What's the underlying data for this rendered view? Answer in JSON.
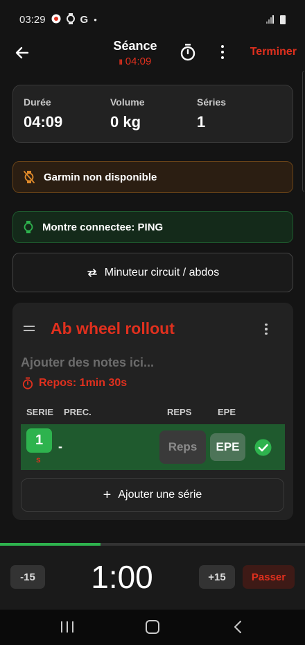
{
  "status_bar": {
    "time": "03:29",
    "icons": [
      "app-notification-icon",
      "watch-icon",
      "google-icon",
      "dot-icon",
      "signal-icon",
      "battery-icon"
    ],
    "google_glyph": "G",
    "dot_glyph": "•"
  },
  "header": {
    "title": "Séance",
    "timer": "04:09",
    "pause_glyph": "II",
    "finish_label": "Terminer"
  },
  "stats": {
    "duration_label": "Durée",
    "duration_value": "04:09",
    "volume_label": "Volume",
    "volume_value": "0 kg",
    "series_label": "Séries",
    "series_value": "1"
  },
  "garmin_banner": {
    "text": "Garmin non disponible",
    "icon": "watch-off-icon"
  },
  "watch_banner": {
    "text": "Montre connectee: PING",
    "icon": "watch-icon"
  },
  "circuit_timer": {
    "label": "Minuteur circuit / abdos",
    "icon": "repeat-icon"
  },
  "exercise": {
    "name": "Ab wheel rollout",
    "notes_placeholder": "Ajouter des notes ici...",
    "rest_label": "Repos: 1min 30s",
    "columns": {
      "serie": "SERIE",
      "prec": "PREC.",
      "reps": "REPS",
      "epe": "EPE"
    },
    "sets": [
      {
        "number": "1",
        "suffix": "s",
        "previous": "-",
        "reps_placeholder": "Reps",
        "epe": "EPE",
        "completed": true
      }
    ],
    "add_set_label": "Ajouter une série",
    "add_set_glyph": "+"
  },
  "rest_timer": {
    "time": "1:00",
    "minus_label": "-15",
    "plus_label": "+15",
    "skip_label": "Passer",
    "progress_fraction": 0.33
  },
  "colors": {
    "accent_red": "#e0301e",
    "success_green": "#2eb34e",
    "row_green": "#1f5a2e"
  }
}
